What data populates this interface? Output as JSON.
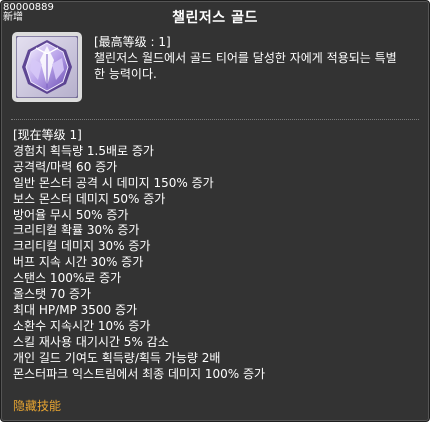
{
  "tooltip": {
    "corner_id": "80000889",
    "corner_tag": "新增",
    "title": "챌린저스 골드",
    "icon_name": "challengers-gold-emblem-icon",
    "max_level": "[最高等级 : 1]",
    "description_lines": [
      "챌린저스 월드에서 골드 티어를 달성한 자에게 적용되는 특별",
      "한 능력이다."
    ],
    "current_level": "[现在等级 1]",
    "effects": [
      "경험치 획득량 1.5배로 증가",
      "공격력/마력 60 증가",
      "일반 몬스터 공격 시 데미지 150% 증가",
      "보스 몬스터  데미지 50% 증가",
      "방어율 무시 50% 증가",
      "크리티컬 확률 30% 증가",
      "크리티컬 데미지 30% 증가",
      "버프 지속 시간 30% 증가",
      "스탠스 100%로 증가",
      "올스탯 70 증가",
      "최대 HP/MP 3500 증가",
      "소환수 지속시간 10% 증가",
      "스킬 재사용 대기시간 5% 감소",
      "개인 길드 기여도 획득량/획득 가능량 2배",
      "몬스터파크 익스트림에서 최종 데미지 100% 증가"
    ],
    "footer": "隐藏技能",
    "colors": {
      "background": "#333333",
      "text": "#ffffff",
      "footer": "#e8a531",
      "icon_frame": "#dcdcdc"
    }
  }
}
